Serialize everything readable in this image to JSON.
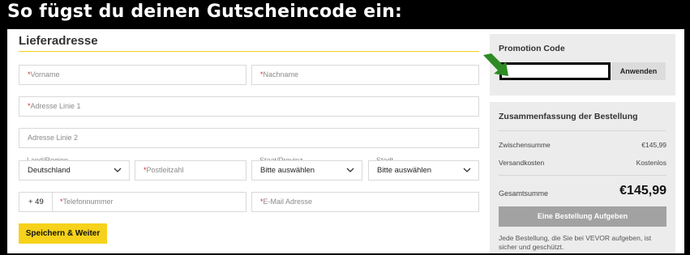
{
  "banner": {
    "title": "So fügst du deinen Gutscheincode ein:"
  },
  "shipping": {
    "heading": "Lieferadresse",
    "fields": {
      "first_name": {
        "req": "*",
        "placeholder": "Vorname"
      },
      "last_name": {
        "req": "*",
        "placeholder": "Nachname"
      },
      "address1": {
        "req": "*",
        "placeholder": "Adresse Linie 1"
      },
      "address2": {
        "placeholder": "Adresse Linie 2"
      },
      "country": {
        "label": "Land/Region",
        "value": "Deutschland"
      },
      "postcode": {
        "req": "*",
        "placeholder": "Postleitzahl"
      },
      "state": {
        "label": "Staat/Provinz",
        "value": "Bitte auswählen"
      },
      "city": {
        "label": "Stadt",
        "value": "Bitte auswählen"
      },
      "phone_code": "+ 49",
      "phone": {
        "req": "*",
        "placeholder": "Telefonnummer"
      },
      "email": {
        "req": "*",
        "placeholder": "E-Mail Adresse"
      }
    },
    "save_label": "Speichern & Weiter"
  },
  "promo": {
    "title": "Promotion Code",
    "input_value": "",
    "apply_label": "Anwenden"
  },
  "summary": {
    "title": "Zusammenfassung der Bestellung",
    "subtotal_label": "Zwischensumme",
    "subtotal_value": "€145,99",
    "shipping_label": "Versandkosten",
    "shipping_value": "Kostenlos",
    "total_label": "Gesamtsumme",
    "total_value": "€145,99",
    "order_button": "Eine Bestellung Aufgeben",
    "note": "Jede Bestellung, die Sie bei VEVOR aufgeben, ist sicher und geschützt."
  },
  "colors": {
    "accent_yellow": "#f7d21a",
    "arrow_green": "#2e8b24",
    "required_red": "#d12b2b"
  },
  "icons": [
    "chevron-down-icon",
    "arrow-icon"
  ]
}
